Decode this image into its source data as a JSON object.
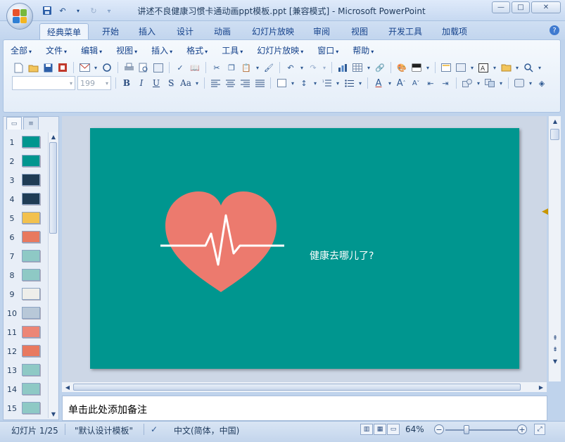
{
  "window": {
    "title": "讲述不良健康习惯卡通动画ppt模板.ppt [兼容模式] - Microsoft PowerPoint",
    "controls": [
      "—",
      "□",
      "✕"
    ]
  },
  "quick_access": {
    "items": [
      "save-icon",
      "undo-icon",
      "redo-icon",
      "customize-icon"
    ]
  },
  "tabs": [
    {
      "label": "经典菜单",
      "active": true
    },
    {
      "label": "开始"
    },
    {
      "label": "插入"
    },
    {
      "label": "设计"
    },
    {
      "label": "动画"
    },
    {
      "label": "幻灯片放映"
    },
    {
      "label": "审阅"
    },
    {
      "label": "视图"
    },
    {
      "label": "开发工具"
    },
    {
      "label": "加载项"
    }
  ],
  "help_label": "?",
  "classic_menu": [
    "全部",
    "文件",
    "编辑",
    "视图",
    "插入",
    "格式",
    "工具",
    "幻灯片放映",
    "窗口",
    "帮助"
  ],
  "toolbar": {
    "font_size": "199",
    "font_name": "",
    "format_buttons": [
      "B",
      "I",
      "U",
      "S",
      "Aa"
    ]
  },
  "slide_panel": {
    "thumbnails": [
      {
        "num": "1",
        "bg": "#00968f"
      },
      {
        "num": "2",
        "bg": "#00968f"
      },
      {
        "num": "3",
        "bg": "#1f3c55"
      },
      {
        "num": "4",
        "bg": "#1f3c55"
      },
      {
        "num": "5",
        "bg": "#f2c14e"
      },
      {
        "num": "6",
        "bg": "#e8795f"
      },
      {
        "num": "7",
        "bg": "#8ec9c5"
      },
      {
        "num": "8",
        "bg": "#8ec9c5"
      },
      {
        "num": "9",
        "bg": "#eeeeea"
      },
      {
        "num": "10",
        "bg": "#b8c8d8"
      },
      {
        "num": "11",
        "bg": "#ec8676"
      },
      {
        "num": "12",
        "bg": "#e8795f"
      },
      {
        "num": "13",
        "bg": "#8ec9c5"
      },
      {
        "num": "14",
        "bg": "#8ec9c5"
      },
      {
        "num": "15",
        "bg": "#8ec9c5"
      }
    ]
  },
  "slide": {
    "background": "#00968f",
    "heart_color": "#ec7a6e",
    "text": "健康去哪儿了?"
  },
  "notes": {
    "placeholder": "单击此处添加备注"
  },
  "status": {
    "slide_info": "幻灯片 1/25",
    "theme": "\"默认设计模板\"",
    "language": "中文(简体，中国)",
    "zoom": "64%",
    "zoom_level_percent": 64
  }
}
